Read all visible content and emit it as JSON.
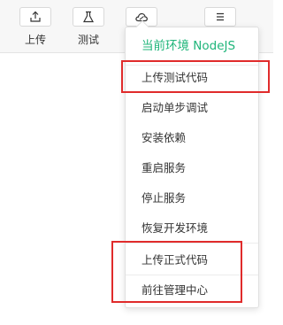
{
  "toolbar": {
    "upload_label": "上传",
    "test_label": "测试"
  },
  "icons": {
    "upload": "upload-icon",
    "test": "flask-icon",
    "cloud": "cloud-icon",
    "menu": "hamburger-menu-icon"
  },
  "dropdown": {
    "env_label": "当前环境 NodeJS",
    "items": [
      "上传测试代码",
      "启动单步调试",
      "安装依赖",
      "重启服务",
      "停止服务",
      "恢复开发环境",
      "上传正式代码",
      "前往管理中心"
    ]
  },
  "colors": {
    "accent": "#1fb57a",
    "highlight": "#e02b2b"
  }
}
